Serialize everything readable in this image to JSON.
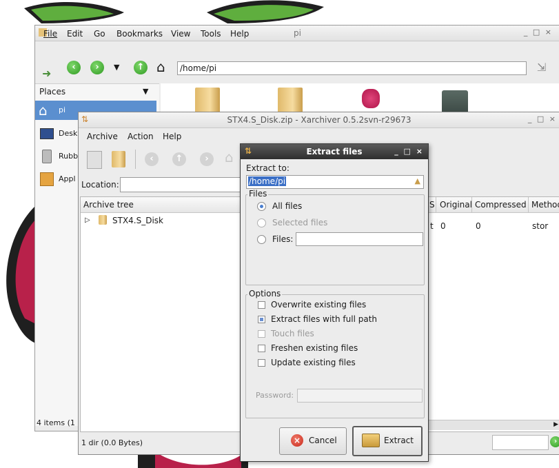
{
  "file_manager": {
    "title": "pi",
    "window_controls": "_ □ ×",
    "menu": [
      "File",
      "Edit",
      "Go",
      "Bookmarks",
      "View",
      "Tools",
      "Help"
    ],
    "path": "/home/pi",
    "places_label": "Places",
    "places": [
      "pi",
      "Desk",
      "Rubb",
      "Appl"
    ],
    "status": "4 items (1"
  },
  "xarchiver": {
    "title": "STX4.S_Disk.zip - Xarchiver 0.5.2svn-r29673",
    "window_controls": "_ □ ×",
    "menu": [
      "Archive",
      "Action",
      "Help"
    ],
    "location_label": "Location:",
    "archive_tree_header": "Archive tree",
    "tree_item": "STX4.S_Disk",
    "columns": [
      "S",
      "Original",
      "Compressed",
      "Method"
    ],
    "row": [
      "t",
      "0",
      "0",
      "stor"
    ],
    "status": "1 dir  (0.0 Bytes)"
  },
  "dialog": {
    "title": "Extract files",
    "window_controls": "_ □ ×",
    "extract_to_label": "Extract to:",
    "extract_to_value": "/home/pi",
    "files_legend": "Files",
    "all_files": "All files",
    "selected_files": "Selected files",
    "files_label": "Files:",
    "files_value": "",
    "options_legend": "Options",
    "opt_overwrite": "Overwrite existing files",
    "opt_full_path": "Extract files with full path",
    "opt_touch": "Touch files",
    "opt_freshen": "Freshen existing files",
    "opt_update": "Update existing files",
    "password_label": "Password:",
    "password_value": "",
    "cancel": "Cancel",
    "extract": "Extract"
  }
}
